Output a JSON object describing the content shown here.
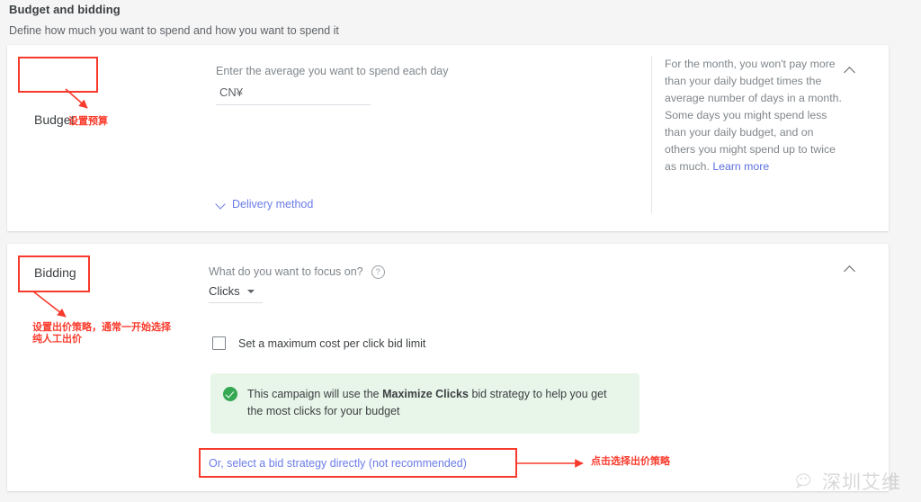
{
  "page": {
    "title": "Budget and bidding",
    "subtitle": "Define how much you want to spend and how you want to spend it"
  },
  "budget_card": {
    "section_label": "Budget",
    "field_label": "Enter the average you want to spend each day",
    "currency_placeholder": "CN¥",
    "currency_value": "",
    "delivery_method_label": "Delivery method",
    "chevron_down_icon": "chevron-down-icon",
    "collapse_icon": "chevron-up-icon",
    "info": {
      "text": "For the month, you won't pay more than your daily budget times the average number of days in a month. Some days you might spend less than your daily budget, and on others you might spend up to twice as much. ",
      "learn_more": "Learn more"
    }
  },
  "bidding_card": {
    "section_label": "Bidding",
    "focus_question": "What do you want to focus on?",
    "help_icon": "help-circle-icon",
    "help_glyph": "?",
    "focus_value": "Clicks",
    "caret_icon": "caret-down-icon",
    "checkbox_label": "Set a maximum cost per click bid limit",
    "checkbox_checked": false,
    "notice": {
      "icon": "check-circle-icon",
      "prefix": "This campaign will use the ",
      "strong": "Maximize Clicks",
      "suffix": " bid strategy to help you get the most clicks for your budget"
    },
    "bid_strategy_link": "Or, select a bid strategy directly (not recommended)",
    "collapse_icon": "chevron-up-icon"
  },
  "annotations": {
    "budget_note": "设置预算",
    "bidding_note": "设置出价策略，通常一开始选择\n纯人工出价",
    "bid_strategy_note": "点击选择出价策略",
    "color": "#f73a2b"
  },
  "watermark": {
    "text": "深圳艾维",
    "icon": "wechat-icon"
  },
  "colors": {
    "page_bg": "#f5f5f5",
    "card_bg": "#ffffff",
    "link": "#6b7ce8",
    "notice_bg": "#e8f5e9",
    "notice_icon": "#34a853",
    "annotation": "#f73a2b"
  }
}
